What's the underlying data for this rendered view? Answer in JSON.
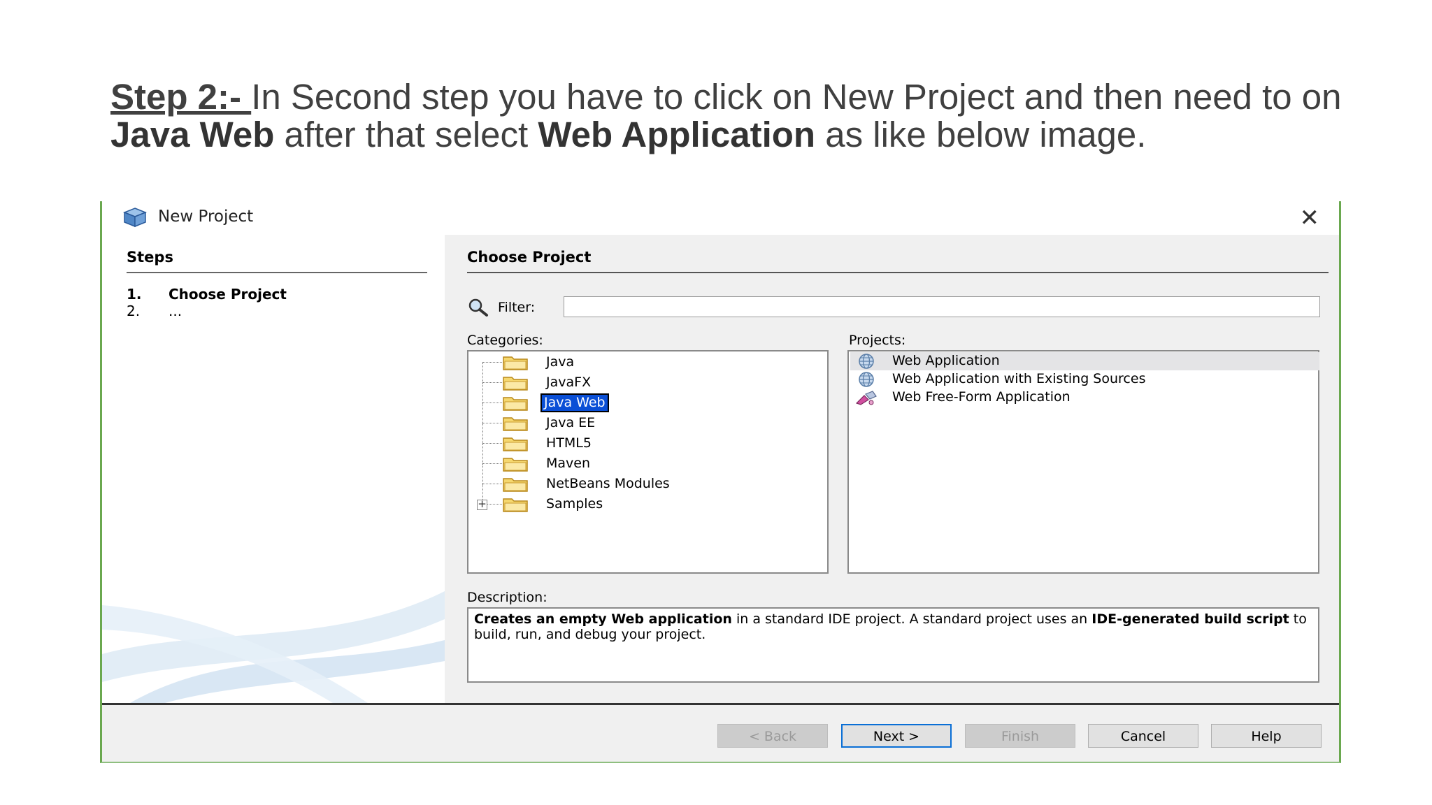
{
  "caption": {
    "step": "Step 2:- ",
    "text1": "In Second step you have to click on New Project and then need to on ",
    "java_web": "Java Web",
    "text2": " after that select ",
    "web_app": "Web Application",
    "text3": " as like below image."
  },
  "dialog": {
    "title": "New Project",
    "close_icon": "close-icon",
    "steps": {
      "heading": "Steps",
      "items": [
        {
          "num": "1.",
          "label": "Choose Project"
        },
        {
          "num": "2.",
          "label": "..."
        }
      ]
    },
    "choose_project": {
      "heading": "Choose Project",
      "filter_label": "Filter:",
      "filter_value": "",
      "categories_label": "Categories:",
      "categories": [
        "Java",
        "JavaFX",
        "Java Web",
        "Java EE",
        "HTML5",
        "Maven",
        "NetBeans Modules",
        "Samples"
      ],
      "selected_category": "Java Web",
      "projects_label": "Projects:",
      "projects": [
        {
          "label": "Web Application",
          "icon": "globe-icon"
        },
        {
          "label": "Web Application with Existing Sources",
          "icon": "globe-icon"
        },
        {
          "label": "Web Free-Form Application",
          "icon": "freeform-icon"
        }
      ],
      "description_label": "Description:",
      "description": {
        "b1": "Creates an empty Web application",
        "t1": " in a standard IDE project. A standard project uses an ",
        "b2": "IDE-generated build script",
        "t2": " to build, run, and debug your project."
      }
    },
    "buttons": {
      "back": "< Back",
      "next": "Next >",
      "finish": "Finish",
      "cancel": "Cancel",
      "help": "Help"
    }
  }
}
